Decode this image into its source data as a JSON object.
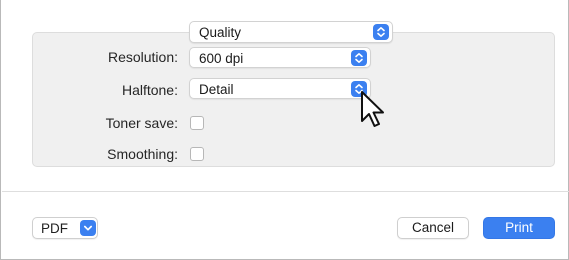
{
  "section_select": {
    "value": "Quality"
  },
  "fields": {
    "resolution": {
      "label": "Resolution:",
      "value": "600 dpi"
    },
    "halftone": {
      "label": "Halftone:",
      "value": "Detail"
    },
    "toner_save": {
      "label": "Toner save:",
      "checked": false
    },
    "smoothing": {
      "label": "Smoothing:",
      "checked": false
    }
  },
  "footer": {
    "pdf_label": "PDF",
    "cancel_label": "Cancel",
    "print_label": "Print"
  },
  "icons": {
    "popup": "chevron-updown-icon",
    "pdf_menu": "chevron-down-icon",
    "cursor": "arrow-cursor-icon"
  },
  "colors": {
    "accent": "#3b80f0",
    "panel_bg": "#f0f0f0"
  }
}
